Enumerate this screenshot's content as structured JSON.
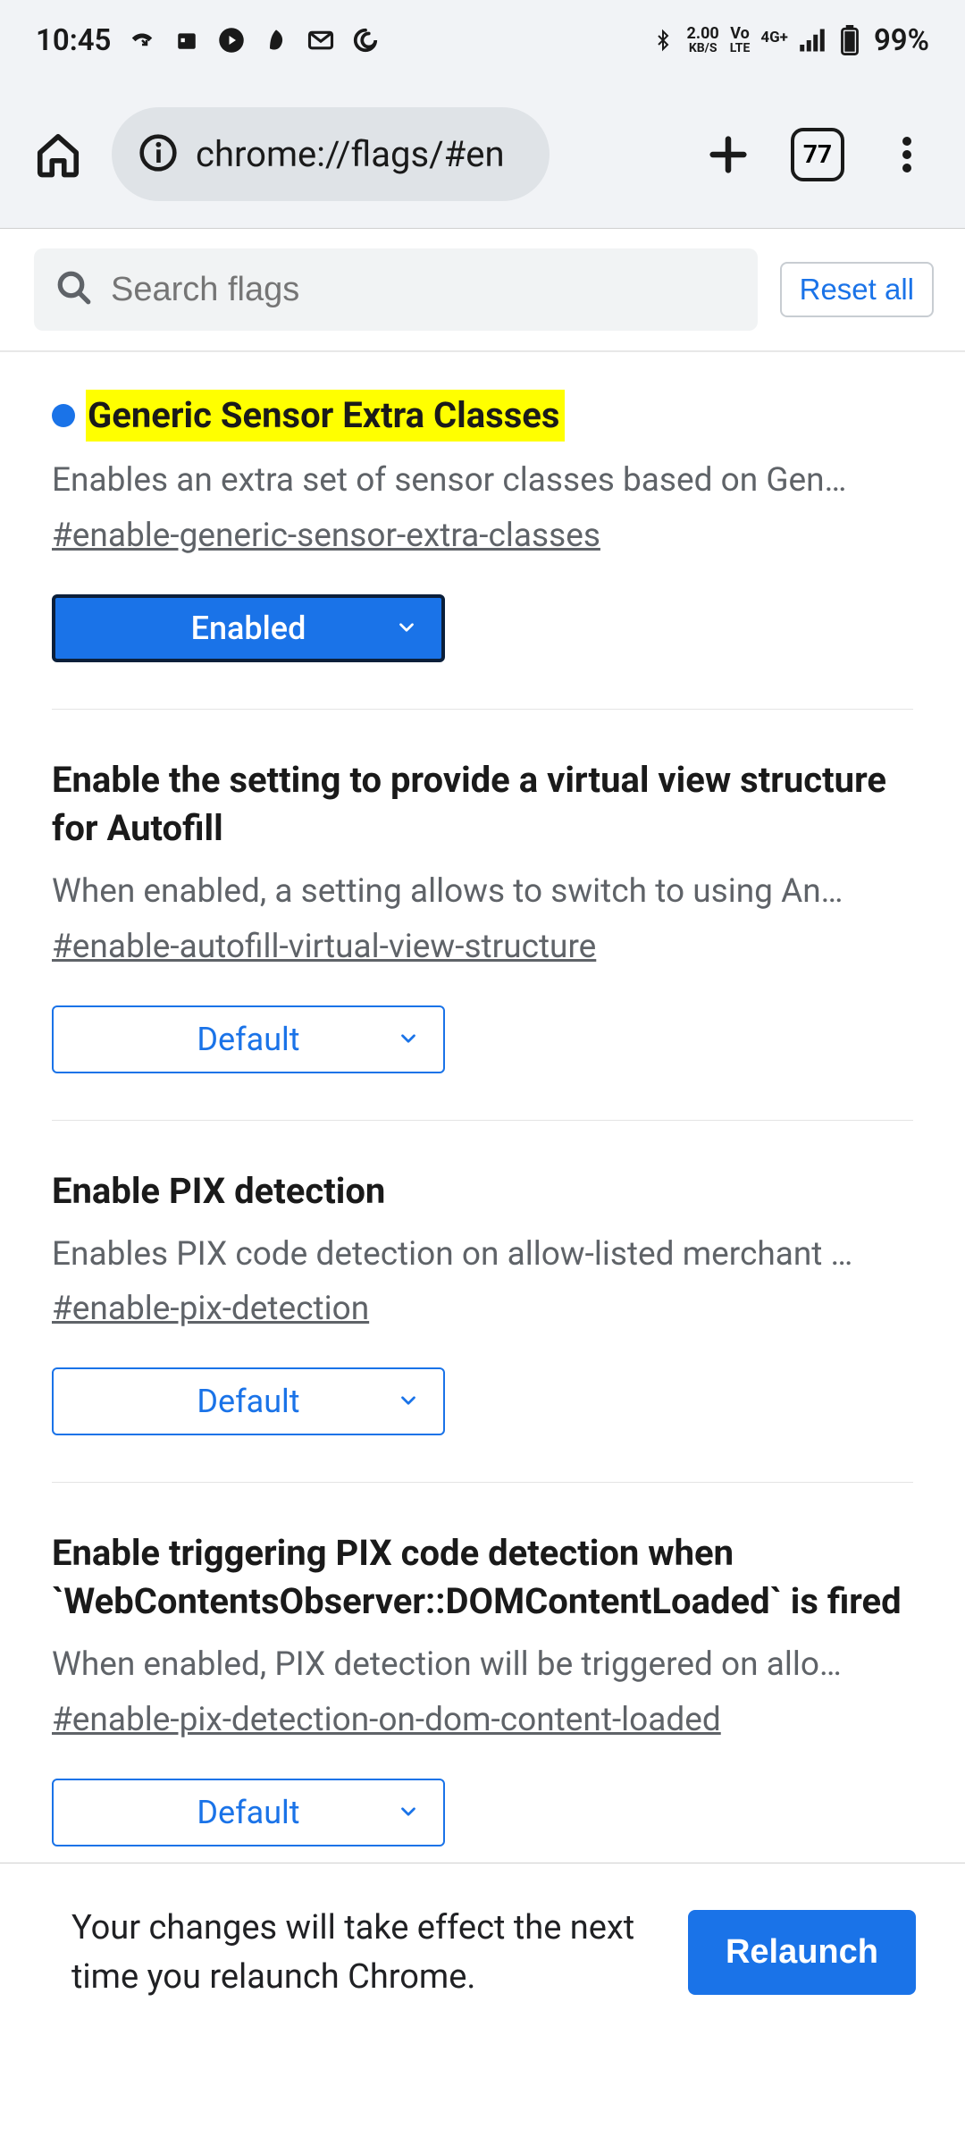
{
  "status": {
    "time": "10:45",
    "data_speed_top": "2.00",
    "data_speed_bottom": "KB/S",
    "volte_top": "Vo",
    "volte_bottom": "LTE",
    "net_gen": "4G+",
    "battery_pct": "99%"
  },
  "chrome": {
    "url": "chrome://flags/#en",
    "tab_count": "77"
  },
  "search": {
    "placeholder": "Search flags",
    "reset_label": "Reset all"
  },
  "flags": [
    {
      "highlighted": true,
      "has_dot": true,
      "title": "Generic Sensor Extra Classes",
      "desc": "Enables an extra set of sensor classes based on Gen…",
      "anchor": "#enable-generic-sensor-extra-classes",
      "value": "Enabled",
      "enabled_style": true
    },
    {
      "highlighted": false,
      "has_dot": false,
      "title": "Enable the setting to provide a virtual view structure for Autofill",
      "desc": "When enabled, a setting allows to switch to using An…",
      "anchor": "#enable-autofill-virtual-view-structure",
      "value": "Default",
      "enabled_style": false
    },
    {
      "highlighted": false,
      "has_dot": false,
      "title": "Enable PIX detection",
      "desc": "Enables PIX code detection on allow-listed merchant …",
      "anchor": "#enable-pix-detection",
      "value": "Default",
      "enabled_style": false
    },
    {
      "highlighted": false,
      "has_dot": false,
      "title": "Enable triggering PIX code detection when `WebContentsObserver::DOMContentLoaded` is fired",
      "desc": "When enabled, PIX detection will be triggered on allo…",
      "anchor": "#enable-pix-detection-on-dom-content-loaded",
      "value": "Default",
      "enabled_style": false
    }
  ],
  "relaunch": {
    "text": "Your changes will take effect the next time you relaunch Chrome.",
    "button": "Relaunch"
  }
}
